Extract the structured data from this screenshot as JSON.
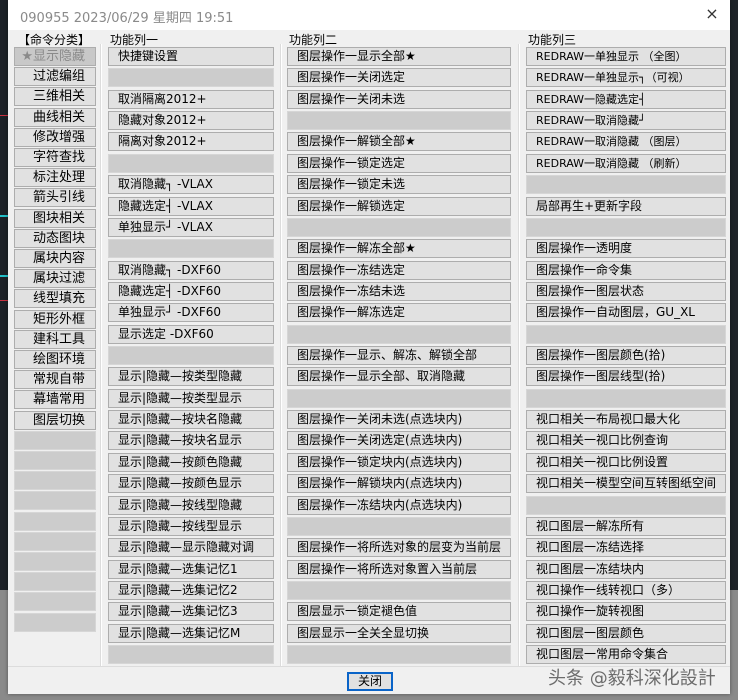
{
  "window": {
    "title": "090955 2023/06/29 星期四 19:51",
    "close_icon": "×"
  },
  "categories": {
    "header": "【命令分类】",
    "items": [
      "★显示隐藏",
      "过滤编组",
      "三维相关",
      "曲线相关",
      "修改增强",
      "字符查找",
      "标注处理",
      "箭头引线",
      "图块相关",
      "动态图块",
      "属块内容",
      "属块过滤",
      "线型填充",
      "矩形外框",
      "建科工具",
      "绘图环境",
      "常规自带",
      "幕墙常用",
      "图层切换",
      "",
      "",
      "",
      "",
      "",
      "",
      "",
      "",
      "",
      ""
    ],
    "active_index": 0
  },
  "column1": {
    "header": "功能列一",
    "items": [
      "快捷键设置",
      "",
      "取消隔离2012+",
      "隐藏对象2012+",
      "隔离对象2012+",
      "",
      "取消隐藏┐ -VLAX",
      "隐藏选定┤ -VLAX",
      "单独显示┘ -VLAX",
      "",
      "取消隐藏┐ -DXF60",
      "隐藏选定┤ -DXF60",
      "单独显示┘ -DXF60",
      "显示选定  -DXF60",
      "",
      "显示|隐藏—按类型隐藏",
      "显示|隐藏—按类型显示",
      "显示|隐藏—按块名隐藏",
      "显示|隐藏—按块名显示",
      "显示|隐藏—按颜色隐藏",
      "显示|隐藏—按颜色显示",
      "显示|隐藏—按线型隐藏",
      "显示|隐藏—按线型显示",
      "显示|隐藏—显示隐藏对调",
      "显示|隐藏—选集记忆1",
      "显示|隐藏—选集记忆2",
      "显示|隐藏—选集记忆3",
      "显示|隐藏—选集记忆M",
      ""
    ]
  },
  "column2": {
    "header": "功能列二",
    "items": [
      "图层操作一显示全部★",
      "图层操作一关闭选定",
      "图层操作一关闭未选",
      "",
      "图层操作一解锁全部★",
      "图层操作一锁定选定",
      "图层操作一锁定未选",
      "图层操作一解锁选定",
      "",
      "图层操作一解冻全部★",
      "图层操作一冻结选定",
      "图层操作一冻结未选",
      "图层操作一解冻选定",
      "",
      "图层操作一显示、解冻、解锁全部",
      "图层操作一显示全部、取消隐藏",
      "",
      "图层操作一关闭未选(点选块内)",
      "图层操作一关闭选定(点选块内)",
      "图层操作一锁定块内(点选块内)",
      "图层操作一解锁块内(点选块内)",
      "图层操作一冻结块内(点选块内)",
      "",
      "图层操作一将所选对象的层变为当前层",
      "图层操作一将所选对象置入当前层",
      "",
      "图层显示一锁定褪色值",
      "图层显示一全关全显切换",
      ""
    ]
  },
  "column3": {
    "header": "功能列三",
    "items": [
      "REDRAW一单独显示 （全图）",
      "REDRAW一单独显示┐（可视）",
      "REDRAW一隐藏选定┤",
      "REDRAW一取消隐藏┘",
      "REDRAW一取消隐藏 （图层）",
      "REDRAW一取消隐藏 （刷新）",
      "",
      "局部再生+更新字段",
      "",
      "图层操作一透明度",
      "图层操作一命令集",
      "图层操作一图层状态",
      "图层操作一自动图层，GU_XL",
      "",
      "图层操作一图层颜色(拾)",
      "图层操作一图层线型(拾)",
      "",
      "视口相关一布局视口最大化",
      "视口相关一视口比例查询",
      "视口相关一视口比例设置",
      "视口相关一模型空间互转图纸空间",
      "",
      "视口图层一解冻所有",
      "视口图层一冻结选择",
      "视口图层一冻结块内",
      "视口操作一线转视口（多）",
      "视口操作一旋转视图",
      "视口图层一图层颜色",
      "视口图层一常用命令集合"
    ]
  },
  "footer": {
    "close_label": "关闭",
    "watermark": "头条 @毅科深化設計"
  }
}
